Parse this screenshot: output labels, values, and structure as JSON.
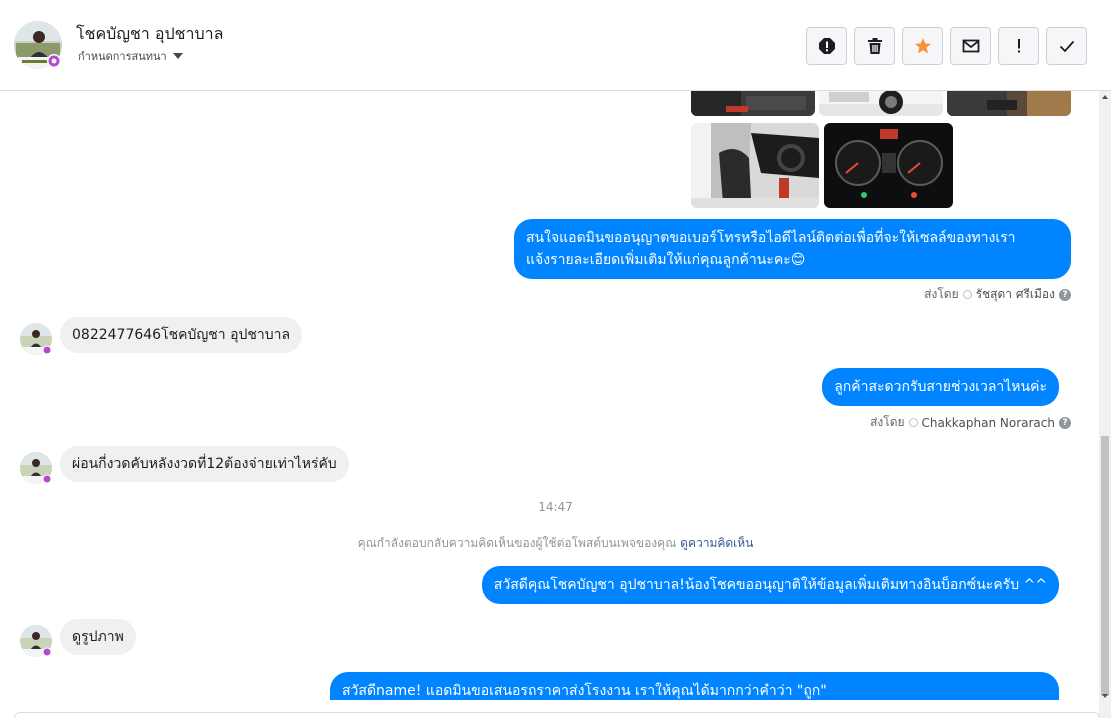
{
  "header": {
    "contact_name": "โชคบัญชา อุปชาบาล",
    "assign_label": "กำหนดการสนทนา",
    "actions": [
      {
        "name": "mark-spam-button",
        "icon": "alert-octagon-icon"
      },
      {
        "name": "delete-button",
        "icon": "trash-icon"
      },
      {
        "name": "star-button",
        "icon": "star-icon"
      },
      {
        "name": "mark-unread-button",
        "icon": "envelope-icon"
      },
      {
        "name": "follow-up-button",
        "icon": "exclamation-icon"
      },
      {
        "name": "mark-done-button",
        "icon": "check-icon"
      }
    ],
    "star_color": "#f7923b"
  },
  "messages": {
    "out1": "สนใจแอดมินขออนุญาตขอเบอร์โทรหรือไอดีไลน์ติดต่อเพื่อที่จะให้เซลล์ของทางเรา",
    "out1_line2": "แจ้งรายละเอียดเพิ่มเติมให้แก่คุณลูกค้านะคะ😊",
    "out1_sent_label": "ส่งโดย",
    "out1_sender": "รัชสุดา ศรีเมือง",
    "in1": "0822477646โชคบัญชา อุปชาบาล",
    "out2": "ลูกค้าสะดวกรับสายช่วงเวลาไหนค่ะ",
    "out2_sent_label": "ส่งโดย",
    "out2_sender": "Chakkaphan Norarach",
    "in2": "ผ่อนกี่งวดคับหลังงวดที่12ต้องจ่ายเท่าไหร่คับ",
    "time": "14:47",
    "system_note": "คุณกำลังตอบกลับความคิดเห็นของผู้ใช้ต่อโพสต์บนเพจของคุณ",
    "system_link": "ดูความคิดเห็น",
    "out3": "สวัสดีคุณโชคบัญชา อุปชาบาล!น้องโชคขออนุญาติให้ข้อมูลเพิ่มเติมทางอินบ็อกซ์นะครับ ^^",
    "in3": "ดูรูปภาพ",
    "out4": "สวัสดีname! แอดมินขอเสนอรถราคาส่งโรงงาน เราให้คุณได้มากกว่าคำว่า \"ถูก\""
  },
  "colors": {
    "bubble_out": "#0084ff",
    "bubble_in": "#f1f0f0",
    "link": "#385898"
  }
}
